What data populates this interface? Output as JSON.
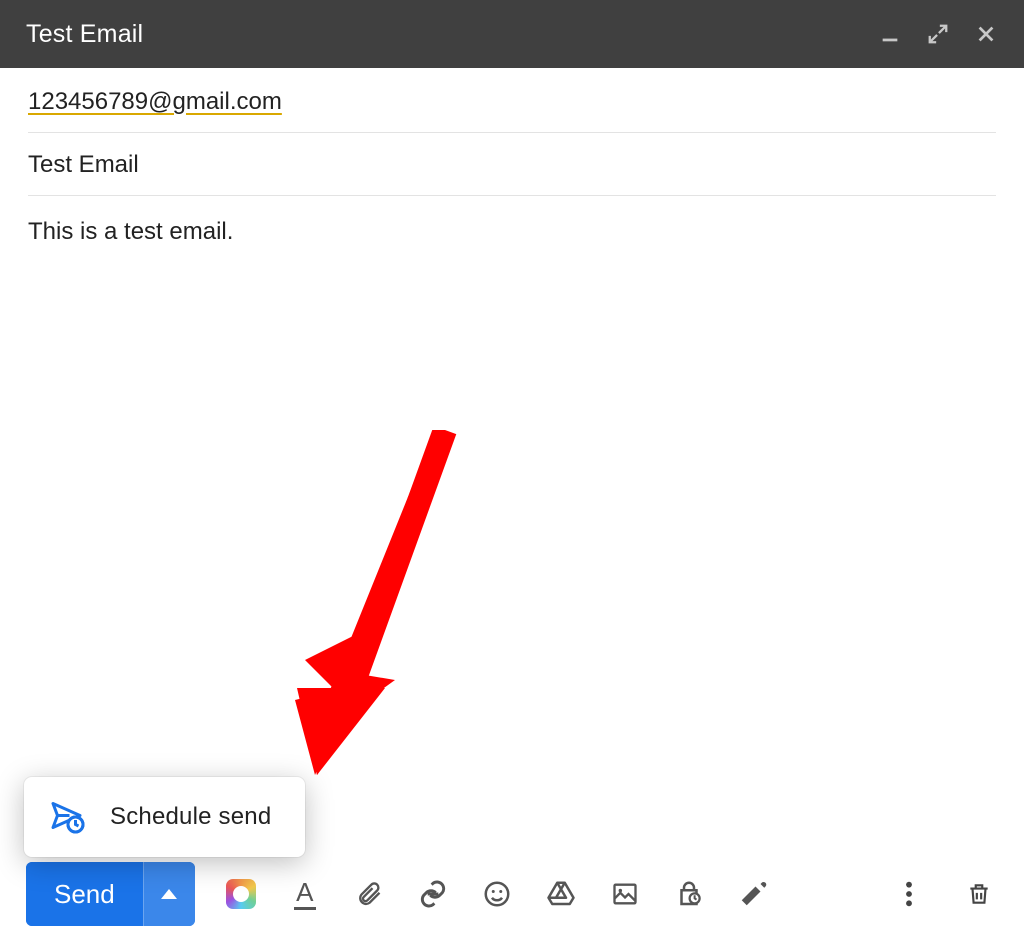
{
  "header": {
    "title": "Test Email",
    "controls": {
      "minimize_icon": "minimize",
      "expand_icon": "expand",
      "close_icon": "close"
    }
  },
  "fields": {
    "recipient": "123456789@gmail.com",
    "subject": "Test Email"
  },
  "body": {
    "content": "This is a test email."
  },
  "popup": {
    "schedule_send_label": "Schedule send",
    "icon": "schedule-send-icon"
  },
  "footer": {
    "send_label": "Send",
    "send_more_icon": "caret-up",
    "toolbar_icons": [
      "style-suggestions-icon",
      "formatting-options-icon",
      "attach-file-icon",
      "insert-link-icon",
      "insert-emoji-icon",
      "insert-drive-file-icon",
      "insert-photo-icon",
      "confidential-mode-icon",
      "insert-signature-icon"
    ],
    "right_icons": [
      "more-options-icon",
      "discard-draft-icon"
    ]
  },
  "colors": {
    "header_bg": "#404040",
    "primary_blue": "#1a73e8",
    "arrow_red": "#ff0000"
  },
  "annotation": {
    "type": "arrow",
    "description": "Red arrow pointing to Schedule send option"
  }
}
